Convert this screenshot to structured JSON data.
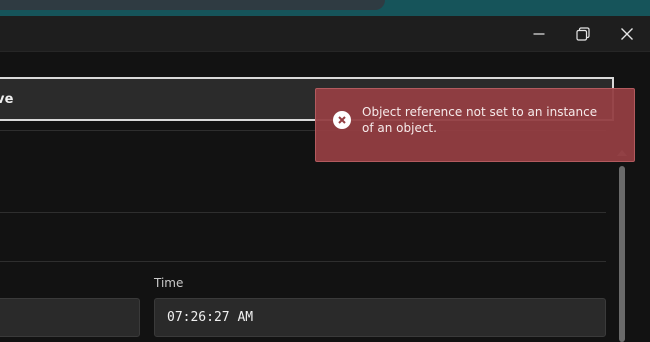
{
  "window": {
    "controls": {
      "minimize_icon": "minimize-icon",
      "maximize_icon": "restore-icon",
      "close_icon": "close-icon"
    }
  },
  "form": {
    "combo_value": "ve",
    "time_label": "Time",
    "time_value": "07:26:27  AM",
    "left_input_value": ""
  },
  "toast": {
    "message": "Object reference not set to an instance of an object.",
    "icon": "error-circle-icon",
    "color": "#943e42"
  }
}
